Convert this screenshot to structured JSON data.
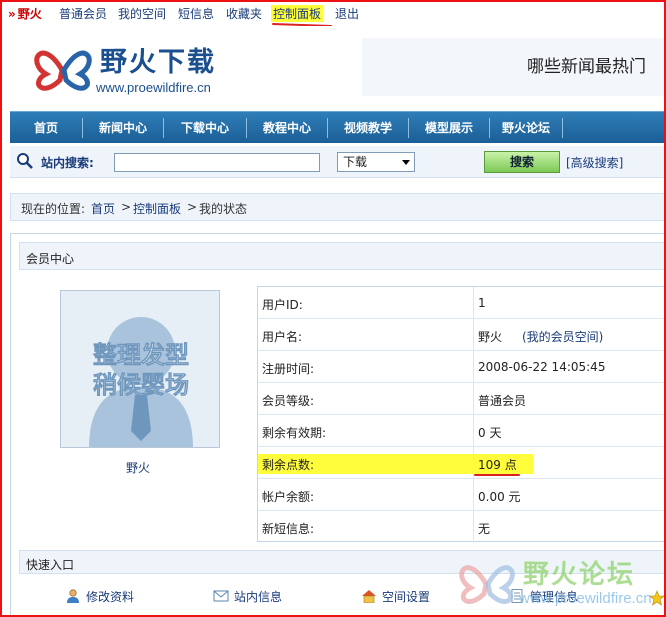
{
  "topbar": {
    "brand": "野火",
    "items": [
      "普通会员",
      "我的空间",
      "短信息",
      "收藏夹",
      "控制面板",
      "退出"
    ]
  },
  "header": {
    "logo_title": "野火下载",
    "logo_url": "www.proewildfire.cn",
    "banner_text": "哪些新闻最热门"
  },
  "nav": {
    "items": [
      "首页",
      "新闻中心",
      "下载中心",
      "教程中心",
      "视频教学",
      "模型展示",
      "野火论坛"
    ]
  },
  "search": {
    "label": "站内搜索:",
    "input_value": "",
    "select_value": "下载",
    "button_label": "搜索",
    "advanced_label": "[高级搜索]"
  },
  "breadcrumb": {
    "prefix": "现在的位置:",
    "items": [
      "首页",
      "控制面板",
      "我的状态"
    ],
    "separator": ">"
  },
  "member": {
    "panel_title": "会员中心",
    "avatar_text": [
      "整理发型",
      "稍候婴场"
    ],
    "name": "野火",
    "rows": [
      {
        "label": "用户ID:",
        "value": "1"
      },
      {
        "label": "用户名:",
        "value": "野火",
        "extra": "(我的会员空间)"
      },
      {
        "label": "注册时间:",
        "value": "2008-06-22 14:05:45"
      },
      {
        "label": "会员等级:",
        "value": "普通会员"
      },
      {
        "label": "剩余有效期:",
        "value": "0 天"
      },
      {
        "label": "剩余点数:",
        "value": "109 点"
      },
      {
        "label": "帐户余额:",
        "value": "0.00 元"
      },
      {
        "label": "新短信息:",
        "value": "无"
      }
    ]
  },
  "quick": {
    "title": "快速入口",
    "items": [
      {
        "label": "修改资料",
        "icon": "user-icon"
      },
      {
        "label": "站内信息",
        "icon": "mail-icon"
      },
      {
        "label": "空间设置",
        "icon": "home-icon"
      },
      {
        "label": "管理信息",
        "icon": "document-icon"
      }
    ]
  },
  "watermark": {
    "title": "野火论坛",
    "url": "www.proewildfire.cn"
  },
  "colors": {
    "accent": "#1b5f96",
    "highlight": "#fffd3b",
    "brand_red": "#cc0000",
    "link": "#1a3b7a"
  }
}
